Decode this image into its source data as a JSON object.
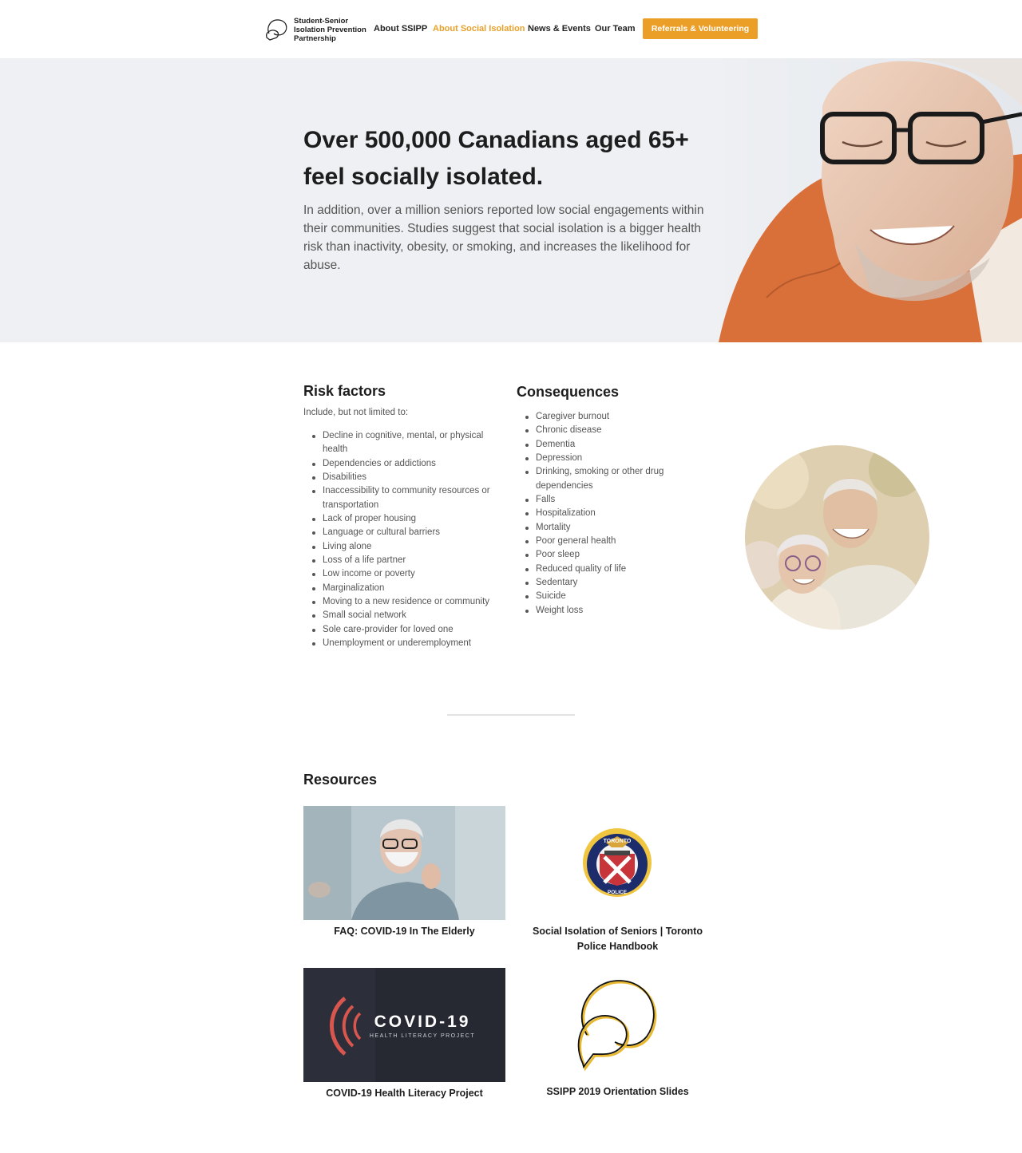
{
  "nav": {
    "logo_text": "Student-Senior Isolation Prevention Partnership",
    "links": [
      "About SSIPP",
      "About Social Isolation",
      "News & Events",
      "Our Team"
    ],
    "cta": "Referrals & Volunteering",
    "accent_color": "#ec9f27"
  },
  "hero": {
    "title": "Over 500,000 Canadians aged 65+ feel socially isolated.",
    "body": "In addition, over a million seniors reported low social engagements within their communities. Studies suggest that social isolation is a bigger health risk than inactivity, obesity, or smoking, and increases the likelihood for abuse."
  },
  "risk": {
    "title": "Risk factors",
    "intro": "Include, but not limited to:",
    "items": [
      "Decline in cognitive, mental, or physical health",
      "Dependencies or addictions",
      "Disabilities",
      "Inaccessibility to community resources or transportation",
      "Lack of proper housing",
      "Language or cultural barriers",
      "Living alone",
      "Loss of a life partner",
      "Low income or poverty",
      "Marginalization",
      "Moving to a new residence or community",
      "Small social network",
      "Sole care-provider for loved one",
      "Unemployment or underemployment"
    ]
  },
  "consequences": {
    "title": "Consequences",
    "items": [
      "Caregiver burnout",
      "Chronic disease",
      "Dementia",
      "Depression",
      "Drinking, smoking or other drug dependencies",
      "Falls",
      "Hospitalization",
      "Mortality",
      "Poor general health",
      "Poor sleep",
      "Reduced quality of life",
      "Sedentary",
      "Suicide",
      "Weight loss"
    ]
  },
  "resources": {
    "title": "Resources",
    "cards": [
      {
        "label": "FAQ: COVID-19 In The Elderly"
      },
      {
        "label": "Social Isolation of Seniors | Toronto Police Handbook",
        "badge_top": "TORONTO",
        "badge_bottom": "POLICE"
      },
      {
        "label": "COVID-19 Health Literacy Project",
        "banner_title": "COVID-19",
        "banner_sub": "HEALTH LITERACY PROJECT"
      },
      {
        "label": "SSIPP 2019 Orientation Slides"
      }
    ]
  }
}
